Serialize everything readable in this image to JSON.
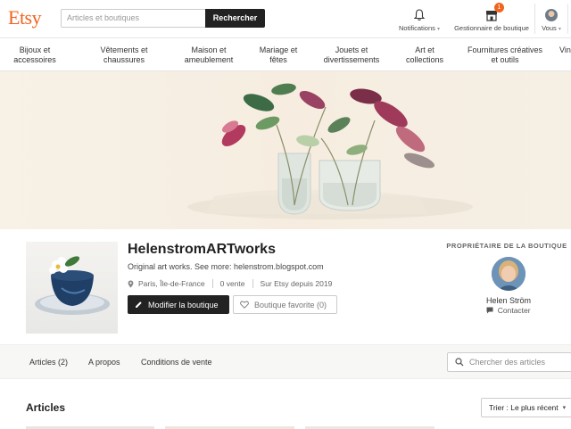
{
  "header": {
    "logo": "Etsy",
    "search_placeholder": "Articles et boutiques",
    "search_button": "Rechercher",
    "notifications": "Notifications",
    "shop_manager": "Gestionnaire de boutique",
    "shop_manager_badge": "1",
    "you": "Vous",
    "caret": "▾"
  },
  "categories": [
    {
      "line1": "Bijoux et",
      "line2": "accessoires"
    },
    {
      "line1": "Vêtements et",
      "line2": "chaussures"
    },
    {
      "line1": "Maison et",
      "line2": "ameublement"
    },
    {
      "line1": "Mariage et",
      "line2": "fêtes"
    },
    {
      "line1": "Jouets et",
      "line2": "divertissements"
    },
    {
      "line1": "Art et",
      "line2": "collections"
    },
    {
      "line1": "Fournitures créatives",
      "line2": "et outils"
    },
    {
      "line1": "Vin",
      "line2": ""
    }
  ],
  "shop": {
    "name": "HelenstromARTworks",
    "description": "Original art works. See more: helenstrom.blogspot.com",
    "location": "Paris, Île-de-France",
    "sales": "0 vente",
    "since": "Sur Etsy depuis 2019",
    "edit_button": "Modifier la boutique",
    "favorite_button": "Boutique favorite (0)"
  },
  "owner": {
    "title": "PROPRIÉTAIRE DE LA BOUTIQUE",
    "name": "Helen Ström",
    "contact": "Contacter"
  },
  "tabs": [
    "Articles (2)",
    "A propos",
    "Conditions de vente"
  ],
  "item_search_placeholder": "Chercher des articles",
  "articles": {
    "title": "Articles",
    "sort": "Trier : Le plus récent",
    "sort_caret": "▾"
  },
  "colors": {
    "brand": "#f1641e",
    "dark_button": "#222222"
  }
}
